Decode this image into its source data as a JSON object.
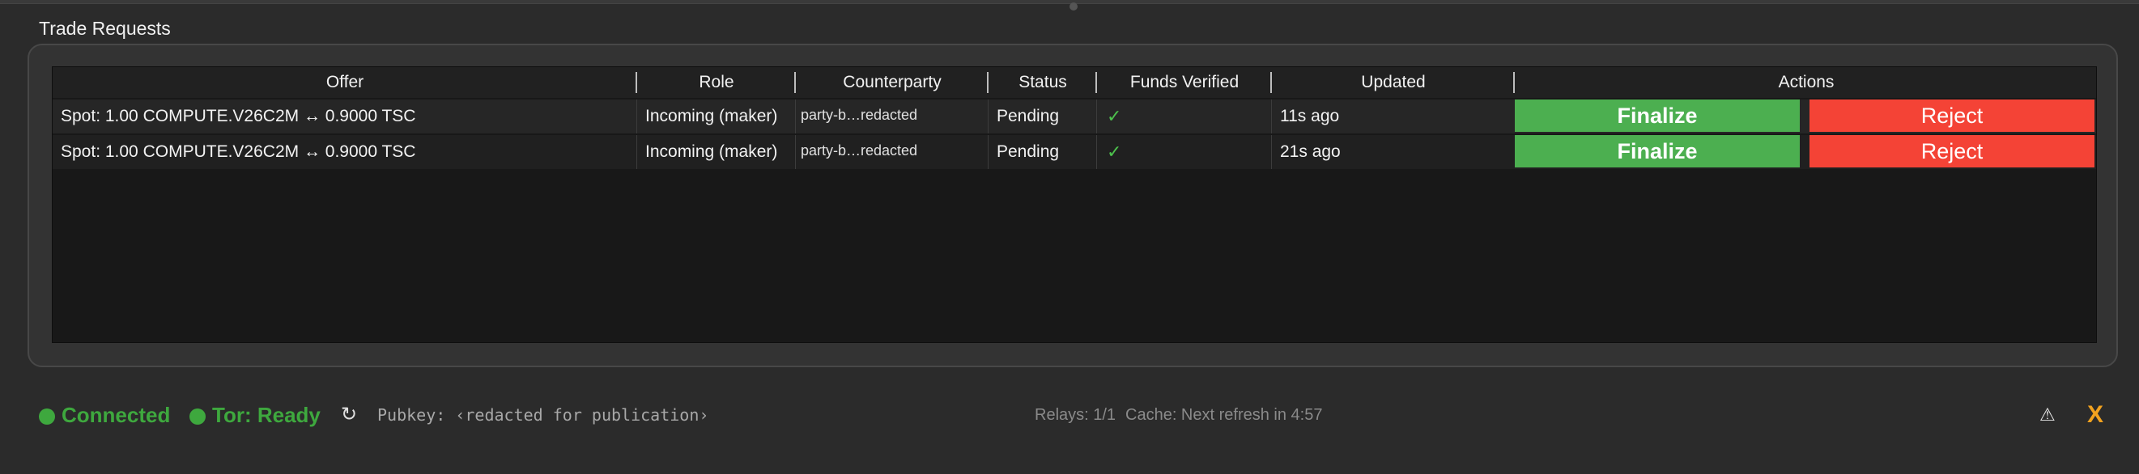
{
  "section": {
    "title": "Trade Requests"
  },
  "table": {
    "columns": [
      "Offer",
      "Role",
      "Counterparty",
      "Status",
      "Funds Verified",
      "Updated",
      "Actions"
    ],
    "rows": [
      {
        "offer": "Spot: 1.00 COMPUTE.V26C2M ↔ 0.9000 TSC",
        "role": "Incoming (maker)",
        "counterparty": "party-b…redacted",
        "status": "Pending",
        "funds_verified": "✓",
        "updated": "11s ago",
        "finalize": "Finalize",
        "reject": "Reject"
      },
      {
        "offer": "Spot: 1.00 COMPUTE.V26C2M ↔ 0.9000 TSC",
        "role": "Incoming (maker)",
        "counterparty": "party-b…redacted",
        "status": "Pending",
        "funds_verified": "✓",
        "updated": "21s ago",
        "finalize": "Finalize",
        "reject": "Reject"
      }
    ]
  },
  "status_bar": {
    "connected": "Connected",
    "tor": "Tor: Ready",
    "refresh_icon": "↻",
    "pubkey": "Pubkey: ‹redacted for publication›",
    "relays": "Relays: 1/1",
    "cache": "Cache: Next refresh in 4:57",
    "warning_icon": "⚠",
    "close": "X"
  },
  "colors": {
    "connected": "#3ea83e",
    "finalize": "#4caf50",
    "reject": "#f44336",
    "close": "#f2a21f"
  }
}
